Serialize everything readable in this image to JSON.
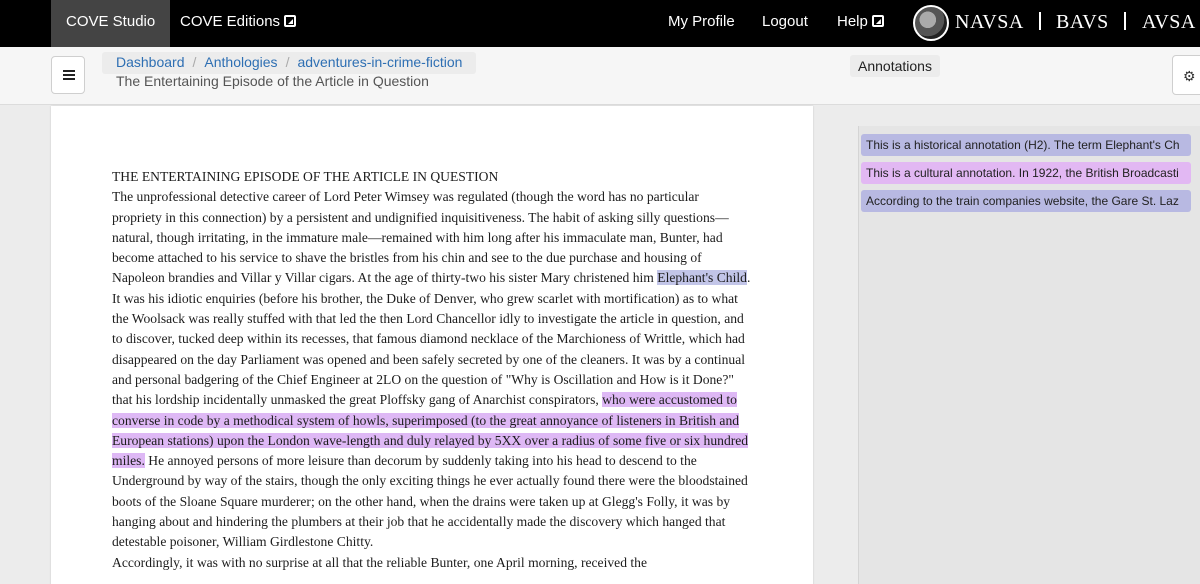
{
  "navbar": {
    "studio": "COVE Studio",
    "editions": "COVE Editions",
    "profile": "My Profile",
    "logout": "Logout",
    "help": "Help",
    "logos": [
      "NAVSA",
      "BAVS",
      "AVSA"
    ]
  },
  "breadcrumb": {
    "items": [
      "Dashboard",
      "Anthologies",
      "adventures-in-crime-fiction"
    ]
  },
  "document": {
    "subtitle": "The Entertaining Episode of the Article in Question",
    "title": "THE ENTERTAINING EPISODE OF THE ARTICLE IN QUESTION",
    "p1_a": "The unprofessional detective career of Lord Peter Wimsey was regulated (though the word has no particular propriety in this connection) by a persistent and undignified inquisitiveness. The habit of asking silly questions—natural, though irritating, in the immature male—remained with him long after his immaculate man, Bunter, had become attached to his service to shave the bristles from his chin and see to the due purchase and housing of Napoleon brandies and Villar y Villar cigars. At the age of thirty-two his sister Mary christened him ",
    "hl1": "Elephant's Child",
    "p1_b": ". It was his idiotic enquiries (before his brother, the Duke of Denver, who grew scarlet with mortification) as to what the Woolsack was really stuffed with that led the then Lord Chancellor idly to investigate the article in question, and to discover, tucked deep within its recesses, that famous diamond necklace of the Marchioness of Writtle, which had disappeared on the day Parliament was opened and been safely secreted by one of the cleaners. It was by a continual and personal badgering of the Chief Engineer at 2LO on the question of \"Why is Oscillation and How is it Done?\" that his lordship incidentally unmasked the great Ploffsky gang of Anarchist conspirators, ",
    "hl2": "who were accustomed to converse in code by a methodical system of howls, superimposed (to the great annoyance of listeners in British and European stations) upon the London wave-length and duly relayed by 5XX over a radius of some five or six hundred miles.",
    "p1_c": " He annoyed persons of more leisure than decorum by suddenly taking into his head to descend to the Underground by way of the stairs, though the only exciting things he ever actually found there were the bloodstained boots of the Sloane Square murderer; on the other hand, when the drains were taken up at Glegg's Folly, it was by hanging about and hindering the plumbers at their job that he accidentally made the discovery which hanged that detestable poisoner, William Girdlestone Chitty.",
    "p2": "Accordingly, it was with no surprise at all that the reliable Bunter, one April morning, received the"
  },
  "annotations_panel": {
    "tab_label": "Annotations",
    "items": [
      {
        "text": "This is a historical annotation (H2). The term Elephant's Ch",
        "color": "#b8b9e2"
      },
      {
        "text": "This is a cultural annotation. In 1922, the British Broadcasti",
        "color": "#e2b8f3"
      },
      {
        "text": "According to the train companies website, the Gare St. Laz",
        "color": "#b8b9e2"
      }
    ]
  },
  "icons": {
    "menu": "hamburger-icon",
    "settings": "gears-icon",
    "external": "external-link-icon"
  }
}
